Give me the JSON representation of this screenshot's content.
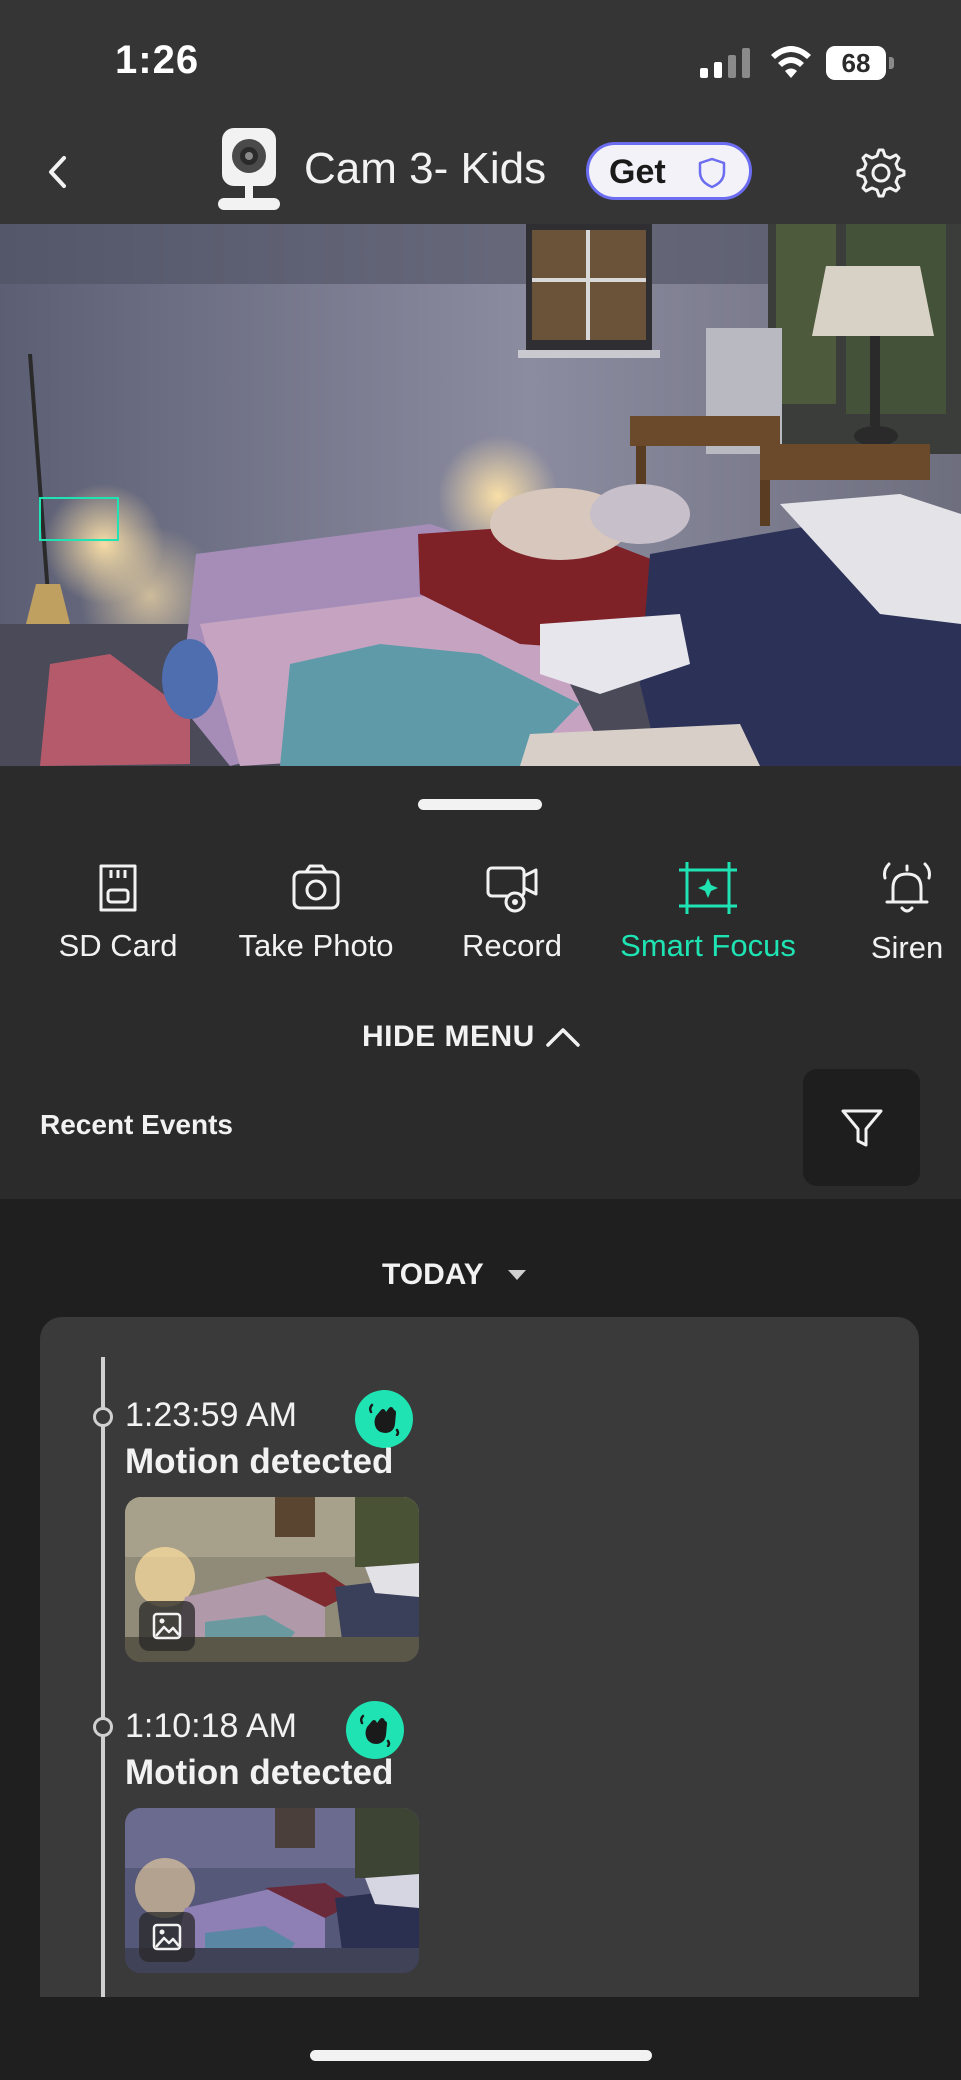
{
  "status_bar": {
    "time": "1:26",
    "battery": "68"
  },
  "header": {
    "back_icon": "chevron-left-icon",
    "camera_icon": "camera-icon",
    "title": "Cam 3- Kids",
    "get_label": "Get",
    "settings_icon": "gear-icon"
  },
  "feed": {
    "description_icon": "camera-feed"
  },
  "menu": {
    "items": [
      {
        "label": "SD Card",
        "icon": "sd-card-icon"
      },
      {
        "label": "Take Photo",
        "icon": "camera-icon"
      },
      {
        "label": "Record",
        "icon": "video-record-icon"
      },
      {
        "label": "Smart Focus",
        "icon": "focus-icon"
      },
      {
        "label": "Siren",
        "icon": "bell-icon"
      }
    ],
    "hide_menu": "HIDE MENU"
  },
  "recent_events": {
    "heading": "Recent Events",
    "filter_icon": "filter-icon"
  },
  "events": {
    "date_filter": "TODAY",
    "items": [
      {
        "time": "1:23:59 AM",
        "title": "Motion detected",
        "badge_icon": "motion-wave-icon"
      },
      {
        "time": "1:10:18 AM",
        "title": "Motion detected",
        "badge_icon": "motion-wave-icon"
      }
    ]
  },
  "colors": {
    "accent": "#1fe3b3",
    "shield_outline": "#6b6cf0",
    "background": "#2b2b2b",
    "panel": "#1f1f1f",
    "card": "#3a3a3a"
  }
}
